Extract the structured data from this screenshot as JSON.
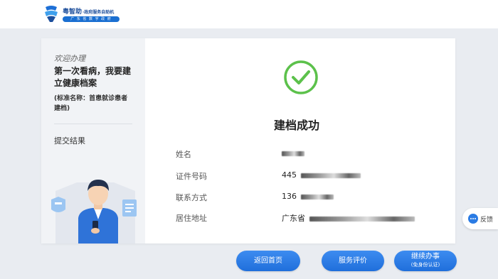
{
  "brand": {
    "name": "粤智助",
    "tagline": "·政府服务自助机",
    "sub": "广 东 省 数 字 政 府"
  },
  "left": {
    "welcome": "欢迎办理",
    "title": "第一次看病，我要建立健康档案",
    "note": "(标准名称：首患就诊患者建档)",
    "step": "提交结果"
  },
  "result": {
    "title": "建档成功",
    "fields": [
      {
        "label": "姓名",
        "value": ""
      },
      {
        "label": "证件号码",
        "value": "445"
      },
      {
        "label": "联系方式",
        "value": "136"
      },
      {
        "label": "居住地址",
        "value": "广东省"
      }
    ]
  },
  "buttons": {
    "home": "返回首页",
    "rate": "服务评价",
    "continue": "继续办事",
    "continue_sub": "(免身份认证)"
  },
  "feedback": "反馈",
  "colors": {
    "accent": "#2a7be4",
    "success": "#5cc14b",
    "background": "#e9ecf1"
  }
}
